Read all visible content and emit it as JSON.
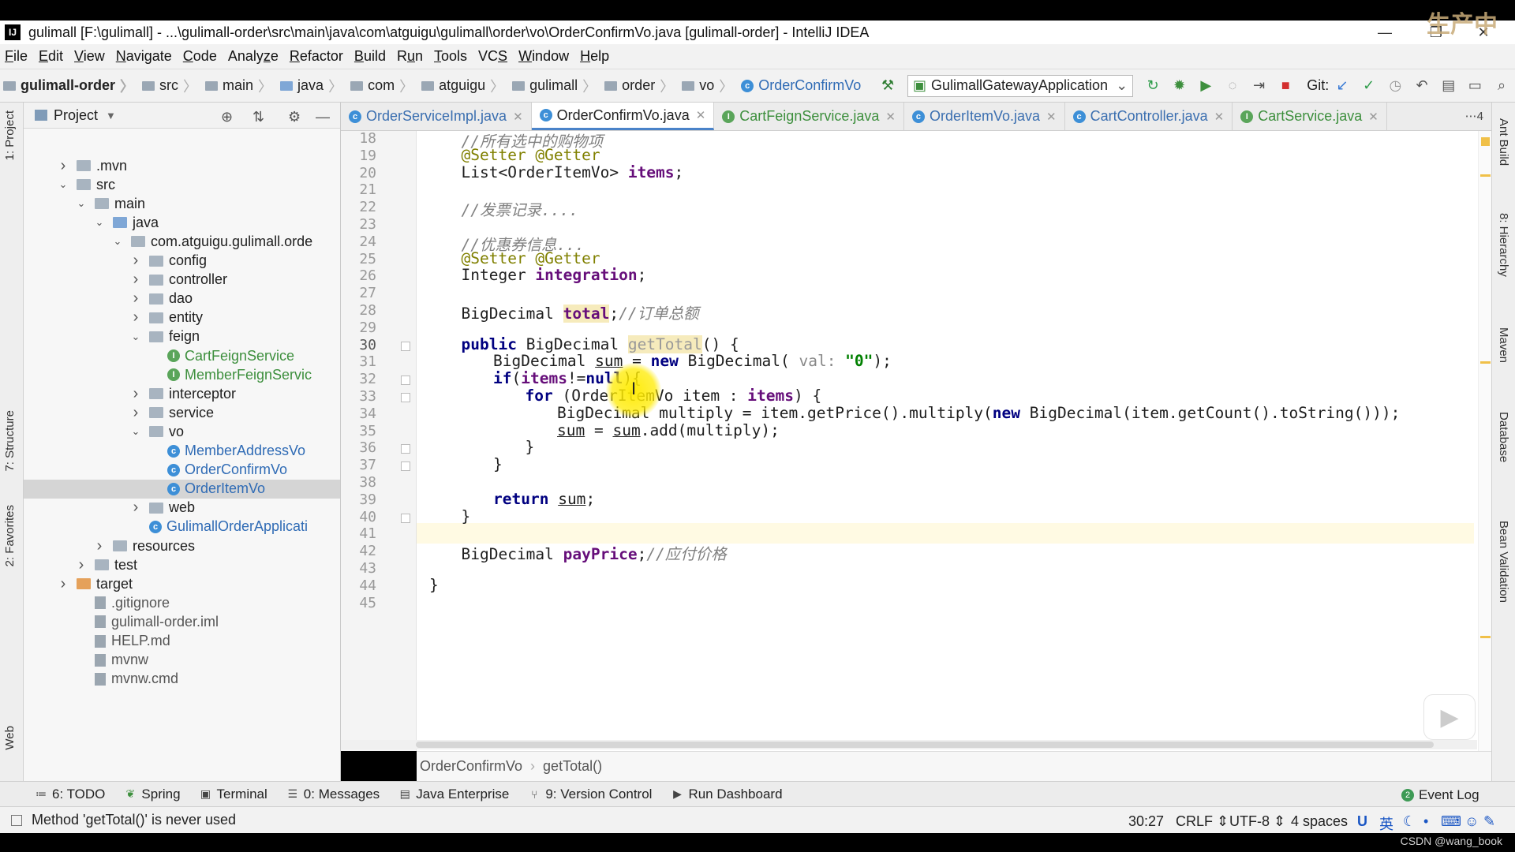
{
  "window": {
    "title": "gulimall [F:\\gulimall] - ...\\gulimall-order\\src\\main\\java\\com\\atguigu\\gulimall\\order\\vo\\OrderConfirmVo.java [gulimall-order] - IntelliJ IDEA"
  },
  "menu": [
    {
      "label": "File",
      "u": "F"
    },
    {
      "label": "Edit",
      "u": "E"
    },
    {
      "label": "View",
      "u": "V"
    },
    {
      "label": "Navigate",
      "u": "N"
    },
    {
      "label": "Code",
      "u": "C"
    },
    {
      "label": "Analyze",
      "u": "z"
    },
    {
      "label": "Refactor",
      "u": "R"
    },
    {
      "label": "Build",
      "u": "B"
    },
    {
      "label": "Run",
      "u": "u"
    },
    {
      "label": "Tools",
      "u": "T"
    },
    {
      "label": "VCS",
      "u": "S"
    },
    {
      "label": "Window",
      "u": "W"
    },
    {
      "label": "Help",
      "u": "H"
    }
  ],
  "nav": {
    "crumbs": [
      "gulimall-order",
      "src",
      "main",
      "java",
      "com",
      "atguigu",
      "gulimall",
      "order",
      "vo",
      "OrderConfirmVo"
    ],
    "run_config": "GulimallGatewayApplication",
    "git_label": "Git:"
  },
  "project_panel": {
    "title": "Project",
    "tree": [
      {
        "label": ".mvn",
        "depth": 1,
        "arrow": "right",
        "icon": "folder"
      },
      {
        "label": "src",
        "depth": 1,
        "arrow": "down",
        "icon": "folder"
      },
      {
        "label": "main",
        "depth": 2,
        "arrow": "down",
        "icon": "folder"
      },
      {
        "label": "java",
        "depth": 3,
        "arrow": "down",
        "icon": "src"
      },
      {
        "label": "com.atguigu.gulimall.orde",
        "depth": 4,
        "arrow": "down",
        "icon": "folder"
      },
      {
        "label": "config",
        "depth": 5,
        "arrow": "right",
        "icon": "folder"
      },
      {
        "label": "controller",
        "depth": 5,
        "arrow": "right",
        "icon": "folder"
      },
      {
        "label": "dao",
        "depth": 5,
        "arrow": "right",
        "icon": "folder"
      },
      {
        "label": "entity",
        "depth": 5,
        "arrow": "right",
        "icon": "folder"
      },
      {
        "label": "feign",
        "depth": 5,
        "arrow": "down",
        "icon": "folder"
      },
      {
        "label": "CartFeignService",
        "depth": 6,
        "arrow": "",
        "icon": "interface"
      },
      {
        "label": "MemberFeignServic",
        "depth": 6,
        "arrow": "",
        "icon": "interface"
      },
      {
        "label": "interceptor",
        "depth": 5,
        "arrow": "right",
        "icon": "folder"
      },
      {
        "label": "service",
        "depth": 5,
        "arrow": "right",
        "icon": "folder"
      },
      {
        "label": "vo",
        "depth": 5,
        "arrow": "down",
        "icon": "folder"
      },
      {
        "label": "MemberAddressVo",
        "depth": 6,
        "arrow": "",
        "icon": "class"
      },
      {
        "label": "OrderConfirmVo",
        "depth": 6,
        "arrow": "",
        "icon": "class"
      },
      {
        "label": "OrderItemVo",
        "depth": 6,
        "arrow": "",
        "icon": "class",
        "selected": true
      },
      {
        "label": "web",
        "depth": 5,
        "arrow": "right",
        "icon": "folder"
      },
      {
        "label": "GulimallOrderApplicati",
        "depth": 5,
        "arrow": "",
        "icon": "class"
      },
      {
        "label": "resources",
        "depth": 3,
        "arrow": "right",
        "icon": "folder"
      },
      {
        "label": "test",
        "depth": 2,
        "arrow": "right",
        "icon": "folder"
      },
      {
        "label": "target",
        "depth": 1,
        "arrow": "right",
        "icon": "orange"
      },
      {
        "label": ".gitignore",
        "depth": 2,
        "arrow": "",
        "icon": "file"
      },
      {
        "label": "gulimall-order.iml",
        "depth": 2,
        "arrow": "",
        "icon": "file"
      },
      {
        "label": "HELP.md",
        "depth": 2,
        "arrow": "",
        "icon": "file"
      },
      {
        "label": "mvnw",
        "depth": 2,
        "arrow": "",
        "icon": "file"
      },
      {
        "label": "mvnw.cmd",
        "depth": 2,
        "arrow": "",
        "icon": "file"
      }
    ]
  },
  "tabs": [
    {
      "label": "OrderServiceImpl.java",
      "type": "class"
    },
    {
      "label": "OrderConfirmVo.java",
      "type": "class",
      "active": true
    },
    {
      "label": "CartFeignService.java",
      "type": "interface"
    },
    {
      "label": "OrderItemVo.java",
      "type": "class"
    },
    {
      "label": "CartController.java",
      "type": "class"
    },
    {
      "label": "CartService.java",
      "type": "interface"
    }
  ],
  "tabs_overflow": "4",
  "editor": {
    "line_numbers": [
      "18",
      "19",
      "20",
      "21",
      "22",
      "23",
      "24",
      "25",
      "26",
      "27",
      "28",
      "29",
      "30",
      "31",
      "32",
      "33",
      "34",
      "35",
      "36",
      "37",
      "38",
      "39",
      "40",
      "41",
      "42",
      "43",
      "44",
      "45"
    ],
    "caret_line": "30",
    "code": {
      "l18": "//所有选中的购物项",
      "l19_ann": "@Setter @Getter",
      "l20_type": "List<OrderItemVo> ",
      "l20_field": "items",
      "l20_end": ";",
      "l22": "//发票记录....",
      "l24": "//优惠券信息...",
      "l25_ann": "@Setter @Getter",
      "l26_type": "Integer ",
      "l26_field": "integration",
      "l26_end": ";",
      "l28_type": "BigDecimal ",
      "l28_field": "total",
      "l28_end": ";",
      "l28_cmt": "//订单总额",
      "l30_kw": "public",
      "l30_type": " BigDecimal ",
      "l30_name": "getTotal",
      "l30_end": "() {",
      "l31_a": "BigDecimal ",
      "l31_var": "sum",
      "l31_b": " = ",
      "l31_new": "new",
      "l31_c": " BigDecimal( ",
      "l31_hint": "val:",
      "l31_str": " \"0\"",
      "l31_end": ");",
      "l32_kw": "if",
      "l32_a": "(",
      "l32_field": "items",
      "l32_b": "!=",
      "l32_null": "null",
      "l32_end": "){",
      "l33_kw": "for",
      "l33_a": " (OrderItemVo item : ",
      "l33_field": "items",
      "l33_end": ") {",
      "l34_a": "BigDecimal multiply = item.getPrice().multiply(",
      "l34_new": "new",
      "l34_b": " BigDecimal(item.getCount().toString()));",
      "l35_var1": "sum",
      "l35_a": " = ",
      "l35_var2": "sum",
      "l35_b": ".add(multiply);",
      "l36": "}",
      "l37": "}",
      "l39_kw": "return",
      "l39_sp": " ",
      "l39_var": "sum",
      "l39_end": ";",
      "l40": "}",
      "l42_type": "BigDecimal ",
      "l42_field": "payPrice",
      "l42_end": ";",
      "l42_cmt": "//应付价格",
      "l44": "}"
    }
  },
  "editor_breadcrumb": [
    "OrderConfirmVo",
    "getTotal()"
  ],
  "tool_windows": [
    {
      "label": "6: TODO",
      "u": "6"
    },
    {
      "label": "Spring",
      "u": ""
    },
    {
      "label": "Terminal",
      "u": ""
    },
    {
      "label": "0: Messages",
      "u": "0"
    },
    {
      "label": "Java Enterprise",
      "u": ""
    },
    {
      "label": "9: Version Control",
      "u": "9"
    },
    {
      "label": "Run Dashboard",
      "u": ""
    }
  ],
  "event_log": "Event Log",
  "status": {
    "message": "Method 'getTotal()' is never used",
    "position": "30:27",
    "line_sep": "CRLF",
    "encoding": "UTF-8",
    "indent": "4 spaces",
    "ime": "英"
  },
  "left_tabs": [
    "1: Project",
    "7: Structure",
    "2: Favorites",
    "Web"
  ],
  "right_tabs": [
    "Ant Build",
    "8: Hierarchy",
    "Maven",
    "Database",
    "Bean Validation"
  ],
  "watermark": "CSDN @wang_book",
  "corner_logo": "生产中"
}
